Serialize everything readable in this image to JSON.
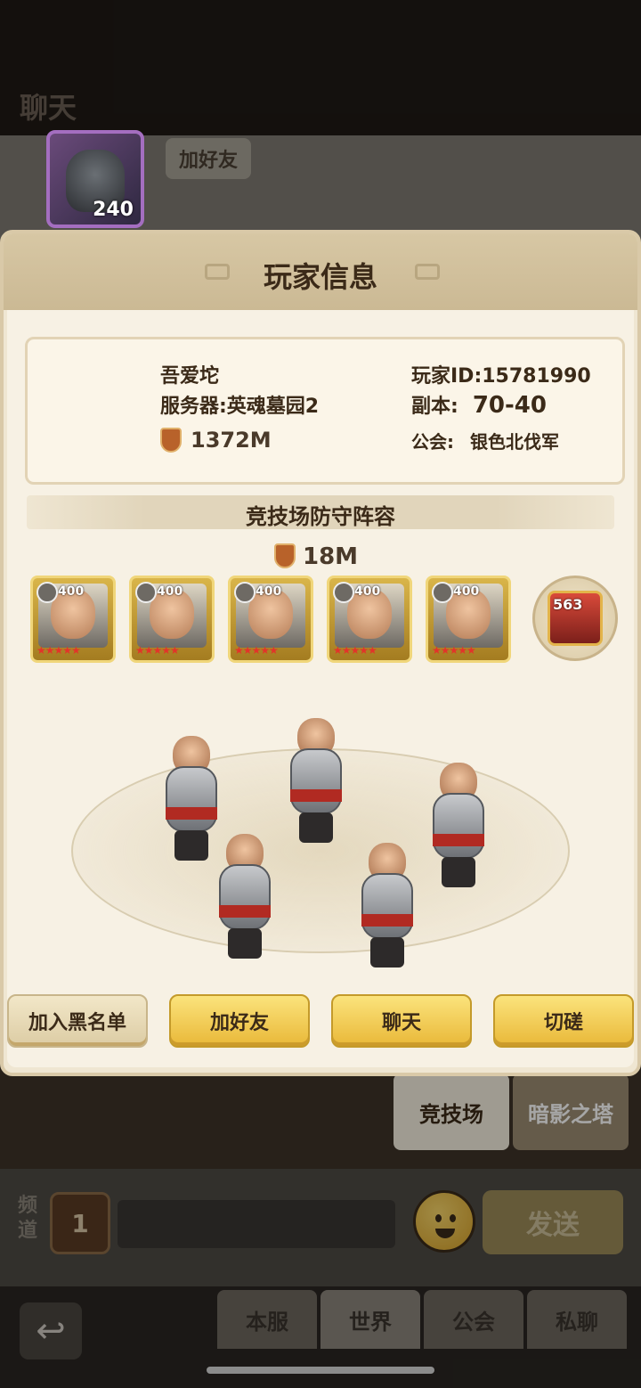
{
  "screen": {
    "title": "聊天"
  },
  "background_message": {
    "avatar_level": "240",
    "add_friend_label": "加好友"
  },
  "dialog": {
    "title": "玩家信息",
    "player": {
      "name": "吾爱坨",
      "server": "服务器:英魂墓园2",
      "avatar_level": "240",
      "power": "1372M",
      "id_label": "玩家ID:",
      "id_value": "15781990",
      "dungeon_label": "副本:",
      "dungeon_value": "70-40",
      "guild_label": "公会:",
      "guild_value": "银色北伐军"
    },
    "lineup": {
      "title": "竞技场防守阵容",
      "power": "18M",
      "heroes": [
        {
          "level": "400",
          "stars": "★★★★★"
        },
        {
          "level": "400",
          "stars": "★★★★★"
        },
        {
          "level": "400",
          "stars": "★★★★★"
        },
        {
          "level": "400",
          "stars": "★★★★★"
        },
        {
          "level": "400",
          "stars": "★★★★★"
        }
      ],
      "pet": {
        "level": "563"
      }
    },
    "actions": {
      "blacklist": "加入黑名单",
      "add_friend": "加好友",
      "chat": "聊天",
      "spar": "切磋"
    }
  },
  "side_tabs": {
    "arena": "竞技场",
    "shadow_tower": "暗影之塔"
  },
  "channel": {
    "label": "频道",
    "number": "1",
    "send": "发送"
  },
  "nav": {
    "tabs": [
      "本服",
      "世界",
      "公会",
      "私聊"
    ],
    "active": "世界"
  },
  "colors": {
    "accent_yellow": "#e9b838",
    "dialog_bg": "#f7f1e4",
    "star_red": "#e2342a"
  }
}
